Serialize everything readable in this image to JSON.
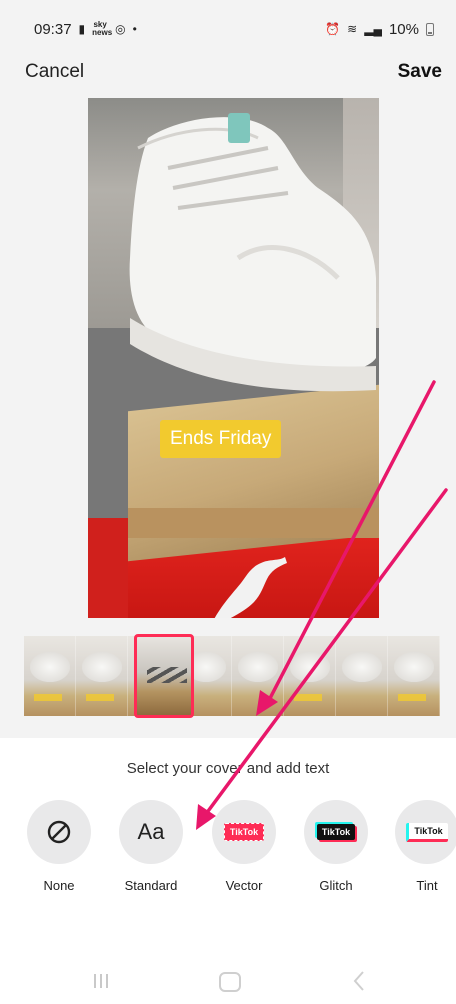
{
  "status_bar": {
    "time": "09:37",
    "sky_icon_text": "sky news",
    "battery": "10%",
    "icons": [
      "notification-dot",
      "instagram-icon",
      "alarm-icon",
      "wifi-icon",
      "signal-icon",
      "battery-icon"
    ]
  },
  "top_bar": {
    "cancel_label": "Cancel",
    "save_label": "Save"
  },
  "preview": {
    "caption": "Ends Friday",
    "caption_color": "#f2ca2e"
  },
  "filmstrip": {
    "frame_count": 8,
    "selected_index": 3,
    "selected_border_color": "#fe2c55"
  },
  "sheet": {
    "hint": "Select your cover and add text",
    "styles": [
      {
        "label": "None",
        "icon": "none-icon"
      },
      {
        "label": "Standard",
        "icon": "Aa"
      },
      {
        "label": "Vector",
        "badge": "TikTok"
      },
      {
        "label": "Glitch",
        "badge": "TikTok"
      },
      {
        "label": "Tint",
        "badge": "TikTok"
      }
    ]
  },
  "annotation_color": "#e8176a"
}
